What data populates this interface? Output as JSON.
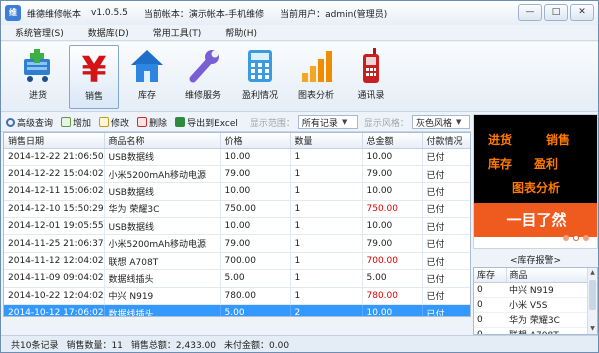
{
  "window": {
    "app_title": "维德维修帐本",
    "version": "v1.0.5.5",
    "current_book": "当前帐本：演示帐本-手机维修",
    "current_user": "当前用户：admin(管理员)",
    "min": "—",
    "max": "□",
    "close": "✕"
  },
  "menu": [
    "系统管理(S)",
    "数据库(D)",
    "常用工具(T)",
    "帮助(H)"
  ],
  "tools": [
    {
      "label": "进货",
      "icon": "cart-add-icon"
    },
    {
      "label": "销售",
      "icon": "yen-icon"
    },
    {
      "label": "库存",
      "icon": "house-icon"
    },
    {
      "label": "维修服务",
      "icon": "wrench-icon"
    },
    {
      "label": "盈利情况",
      "icon": "calculator-icon"
    },
    {
      "label": "图表分析",
      "icon": "bar-chart-icon"
    },
    {
      "label": "通讯录",
      "icon": "phone-icon"
    }
  ],
  "query": {
    "advanced": "高级查询",
    "add": "增加",
    "edit": "修改",
    "delete": "删除",
    "export": "导出到Excel",
    "range_label": "显示范围：",
    "range_value": "所有记录",
    "style_label": "显示风格：",
    "style_value": "灰色风格"
  },
  "table": {
    "headers": [
      "销售日期",
      "商品名称",
      "价格",
      "数量",
      "总金额",
      "付款情况"
    ],
    "rows": [
      {
        "date": "2014-12-22 21:06:50",
        "name": "USB数据线",
        "price": "10.00",
        "qty": "1",
        "total": "10.00",
        "pay": "已付",
        "red": false
      },
      {
        "date": "2014-12-22 15:04:02",
        "name": "小米5200mAh移动电源",
        "price": "79.00",
        "qty": "1",
        "total": "79.00",
        "pay": "已付",
        "red": false
      },
      {
        "date": "2014-12-11 15:06:02",
        "name": "USB数据线",
        "price": "10.00",
        "qty": "1",
        "total": "10.00",
        "pay": "已付",
        "red": false
      },
      {
        "date": "2014-12-10 15:50:29",
        "name": "华为 荣耀3C",
        "price": "750.00",
        "qty": "1",
        "total": "750.00",
        "pay": "已付",
        "red": true
      },
      {
        "date": "2014-12-01 19:05:55",
        "name": "USB数据线",
        "price": "10.00",
        "qty": "1",
        "total": "10.00",
        "pay": "已付",
        "red": false
      },
      {
        "date": "2014-11-25 21:06:37",
        "name": "小米5200mAh移动电源",
        "price": "79.00",
        "qty": "1",
        "total": "79.00",
        "pay": "已付",
        "red": false
      },
      {
        "date": "2014-11-12 12:04:02",
        "name": "联想 A708T",
        "price": "700.00",
        "qty": "1",
        "total": "700.00",
        "pay": "已付",
        "red": true
      },
      {
        "date": "2014-11-09 09:04:02",
        "name": "数据线插头",
        "price": "5.00",
        "qty": "1",
        "total": "5.00",
        "pay": "已付",
        "red": false
      },
      {
        "date": "2014-10-22 12:04:02",
        "name": "中兴 N919",
        "price": "780.00",
        "qty": "1",
        "total": "780.00",
        "pay": "已付",
        "red": true
      },
      {
        "date": "2014-10-12 17:06:02",
        "name": "数据线插头",
        "price": "5.00",
        "qty": "2",
        "total": "10.00",
        "pay": "已付",
        "red": false
      }
    ],
    "selected_index": 9
  },
  "status": {
    "records": "共10条记录",
    "sales_qty": "销售数量：11",
    "sales_total": "销售总额：2,433.00",
    "unpaid": "未付金额：0.00"
  },
  "ad": {
    "words": [
      "进货",
      "销售",
      "库存",
      "盈利",
      "图表分析"
    ],
    "banner": "一目了然",
    "active_dot": 1
  },
  "inventory": {
    "title": "<库存报警>",
    "headers": [
      "库存",
      "商品"
    ],
    "rows": [
      {
        "stock": "0",
        "name": "中兴 N919"
      },
      {
        "stock": "0",
        "name": "小米 V5S"
      },
      {
        "stock": "0",
        "name": "华为 荣耀3C"
      },
      {
        "stock": "0",
        "name": "联想 A708T"
      }
    ]
  },
  "colors": {
    "accent": "#3399ff",
    "warning": "#e00000",
    "ad_orange": "#ef5a1e"
  }
}
